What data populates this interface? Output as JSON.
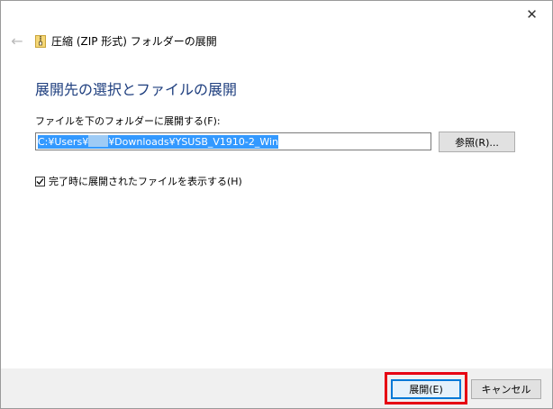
{
  "window": {
    "title": "圧縮 (ZIP 形式) フォルダーの展開",
    "close_label": "✕",
    "back_label": "←"
  },
  "main": {
    "heading": "展開先の選択とファイルの展開",
    "destination_label": "ファイルを下のフォルダーに展開する(F):",
    "path_prefix": "C:¥Users¥",
    "path_suffix": "¥Downloads¥YSUSB_V1910-2_Win",
    "browse_label": "参照(R)...",
    "show_files_label": "完了時に展開されたファイルを表示する(H)",
    "show_files_checked": true
  },
  "footer": {
    "extract_label": "展開(E)",
    "cancel_label": "キャンセル"
  },
  "colors": {
    "heading": "#1f3f7f",
    "selection": "#3399ff",
    "highlight": "#e60012"
  },
  "icons": {
    "zip_folder": "zip-folder-icon",
    "back": "back-arrow-icon",
    "close": "close-icon",
    "check": "checkmark-icon"
  }
}
